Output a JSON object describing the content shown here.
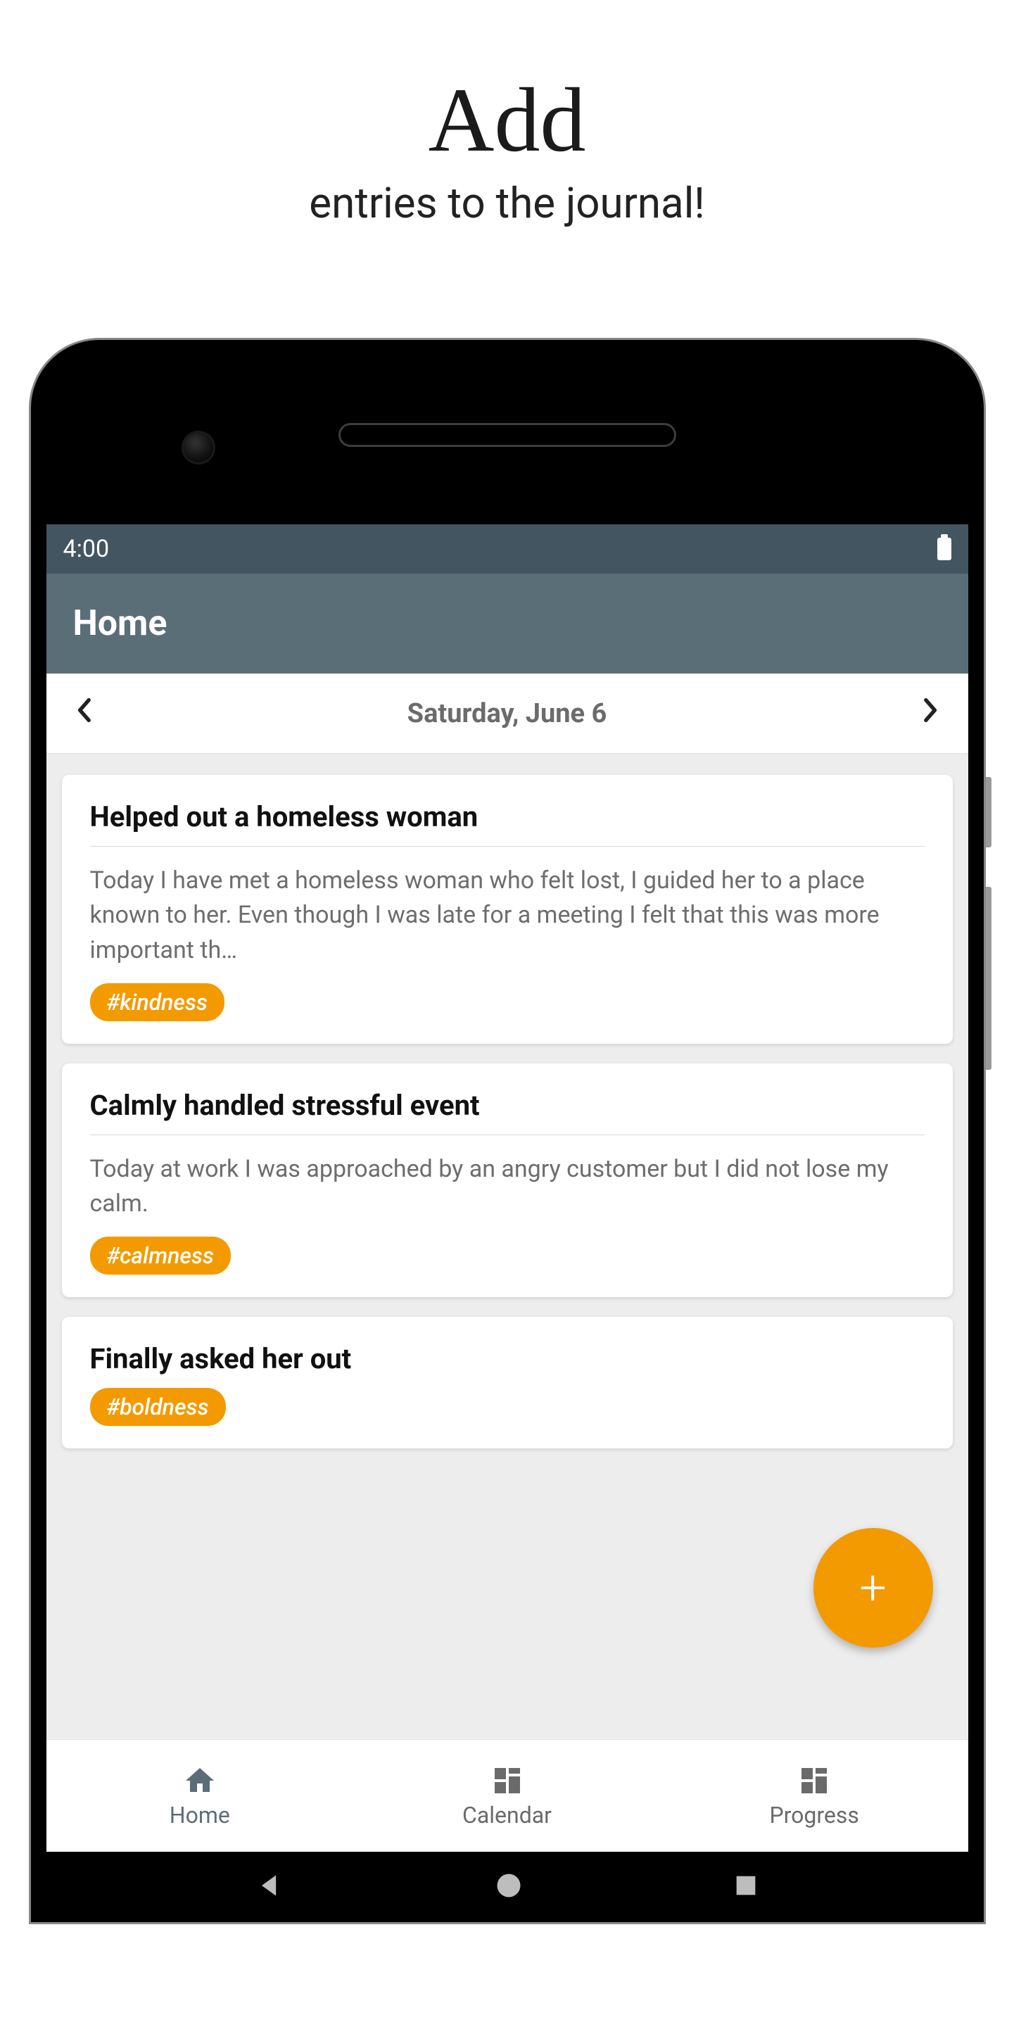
{
  "promo": {
    "title": "Add",
    "subtitle": "entries to the journal!"
  },
  "statusbar": {
    "time": "4:00"
  },
  "header": {
    "title": "Home"
  },
  "date_nav": {
    "date": "Saturday, June 6"
  },
  "entries": [
    {
      "title": "Helped out a homeless woman",
      "body": "Today I have met a homeless woman who felt lost, I guided her to a place known to her. Even though I was late for a meeting I felt that this was more important th…",
      "tag": "#kindness"
    },
    {
      "title": "Calmly handled stressful event",
      "body": "Today at work I was approached by an angry customer but I did not lose my calm.",
      "tag": "#calmness"
    },
    {
      "title": "Finally asked her out",
      "body": "",
      "tag": "#boldness"
    }
  ],
  "bottom_nav": {
    "items": [
      {
        "label": "Home",
        "active": true
      },
      {
        "label": "Calendar",
        "active": false
      },
      {
        "label": "Progress",
        "active": false
      }
    ]
  },
  "colors": {
    "accent": "#f39a00",
    "header": "#5a6e78",
    "statusbar": "#435560"
  }
}
